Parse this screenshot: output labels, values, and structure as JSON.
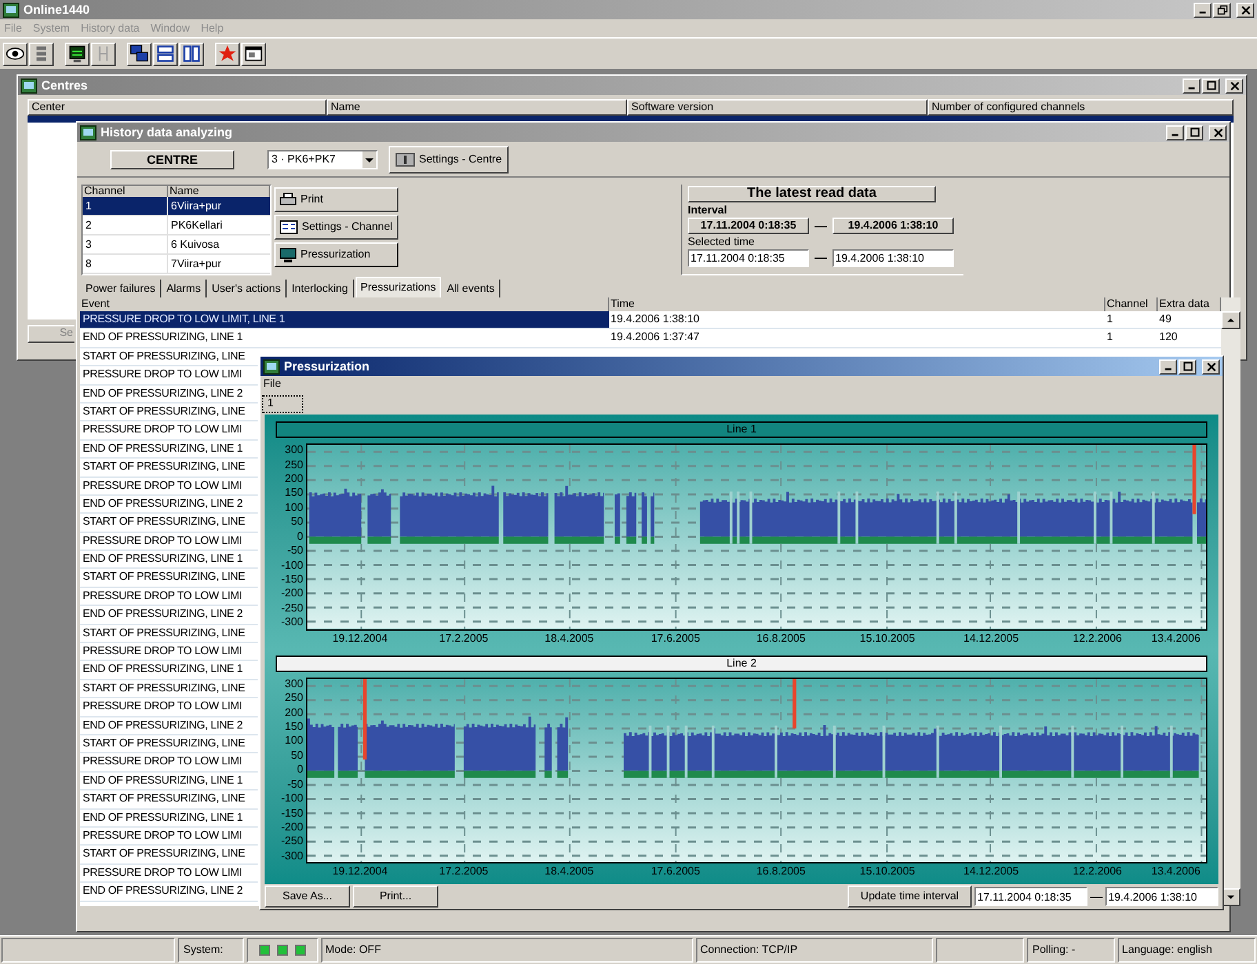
{
  "app": {
    "title": "Online1440",
    "active": false,
    "menu": [
      "File",
      "System",
      "History data",
      "Window",
      "Help"
    ]
  },
  "centres": {
    "title": "Centres",
    "active": false,
    "columns": [
      "Center",
      "Name",
      "Software version",
      "Number of configured channels"
    ],
    "button": "Se"
  },
  "history": {
    "title": "History data analyzing",
    "active": false,
    "centre_label": "CENTRE",
    "centre_value": "3 · PK6+PK7",
    "settings_centre": "Settings - Centre",
    "channels": {
      "columns": [
        "Channel",
        "Name"
      ],
      "rows": [
        {
          "channel": "1",
          "name": "6Viira+pur",
          "selected": true
        },
        {
          "channel": "2",
          "name": "PK6Kellari",
          "selected": false
        },
        {
          "channel": "3",
          "name": "6 Kuivosa",
          "selected": false
        },
        {
          "channel": "8",
          "name": "7Viira+pur",
          "selected": false
        }
      ]
    },
    "actions": [
      {
        "kind": "print",
        "label": "Print"
      },
      {
        "kind": "settings",
        "label": "Settings - Channel"
      },
      {
        "kind": "monitor",
        "label": "Pressurization"
      }
    ],
    "latest": {
      "title": "The latest read data",
      "interval_label": "Interval",
      "interval_from": "17.11.2004 0:18:35",
      "interval_sep": "—",
      "interval_to": "19.4.2006 1:38:10",
      "selected_label": "Selected time",
      "selected_from": "17.11.2004 0:18:35",
      "selected_sep": "—",
      "selected_to": "19.4.2006 1:38:10"
    },
    "tabs": [
      {
        "label": "Power failures",
        "selected": false
      },
      {
        "label": "Alarms",
        "selected": false
      },
      {
        "label": "User's actions",
        "selected": false
      },
      {
        "label": "Interlocking",
        "selected": false
      },
      {
        "label": "Pressurizations",
        "selected": true
      },
      {
        "label": "All events",
        "selected": false
      }
    ],
    "events": {
      "columns": [
        "Event",
        "Time",
        "Channel",
        "Extra data"
      ],
      "rows": [
        {
          "event": "PRESSURE DROP TO LOW LIMIT, LINE 1",
          "time": "19.4.2006 1:38:10",
          "channel": "1",
          "extra": "49",
          "selected": true
        },
        {
          "event": "END OF PRESSURIZING, LINE 1",
          "time": "19.4.2006 1:37:47",
          "channel": "1",
          "extra": "120",
          "selected": false
        },
        {
          "event": "START OF PRESSURIZING, LINE",
          "selected": false
        },
        {
          "event": "PRESSURE DROP TO LOW LIMI",
          "selected": false
        },
        {
          "event": "END OF PRESSURIZING, LINE 2",
          "selected": false
        },
        {
          "event": "START OF PRESSURIZING, LINE",
          "selected": false
        },
        {
          "event": "PRESSURE DROP TO LOW LIMI",
          "selected": false
        },
        {
          "event": "END OF PRESSURIZING, LINE 1",
          "selected": false
        },
        {
          "event": "START OF PRESSURIZING, LINE",
          "selected": false
        },
        {
          "event": "PRESSURE DROP TO LOW LIMI",
          "selected": false
        },
        {
          "event": "END OF PRESSURIZING, LINE 2",
          "selected": false
        },
        {
          "event": "START OF PRESSURIZING, LINE",
          "selected": false
        },
        {
          "event": "PRESSURE DROP TO LOW LIMI",
          "selected": false
        },
        {
          "event": "END OF PRESSURIZING, LINE 1",
          "selected": false
        },
        {
          "event": "START OF PRESSURIZING, LINE",
          "selected": false
        },
        {
          "event": "PRESSURE DROP TO LOW LIMI",
          "selected": false
        },
        {
          "event": "END OF PRESSURIZING, LINE 2",
          "selected": false
        },
        {
          "event": "START OF PRESSURIZING, LINE",
          "selected": false
        },
        {
          "event": "PRESSURE DROP TO LOW LIMI",
          "selected": false
        },
        {
          "event": "END OF PRESSURIZING, LINE 1",
          "selected": false
        },
        {
          "event": "START OF PRESSURIZING, LINE",
          "selected": false
        },
        {
          "event": "PRESSURE DROP TO LOW LIMI",
          "selected": false
        },
        {
          "event": "END OF PRESSURIZING, LINE 2",
          "selected": false
        },
        {
          "event": "START OF PRESSURIZING, LINE",
          "selected": false
        },
        {
          "event": "PRESSURE DROP TO LOW LIMI",
          "selected": false
        },
        {
          "event": "END OF PRESSURIZING, LINE 1",
          "selected": false
        },
        {
          "event": "START OF PRESSURIZING, LINE",
          "selected": false
        },
        {
          "event": "END OF PRESSURIZING, LINE 1",
          "selected": false
        },
        {
          "event": "PRESSURE DROP TO LOW LIMI",
          "selected": false
        },
        {
          "event": "START OF PRESSURIZING, LINE",
          "selected": false
        },
        {
          "event": "PRESSURE DROP TO LOW LIMI",
          "selected": false
        },
        {
          "event": "END OF PRESSURIZING, LINE 2",
          "selected": false
        }
      ]
    }
  },
  "pressurization": {
    "title": "Pressurization",
    "active": true,
    "menu": [
      "File"
    ],
    "tabs": [
      {
        "label": "1",
        "selected": true
      }
    ],
    "charts": [
      {
        "title": "Line 1",
        "yticks": [
          "300",
          "250",
          "200",
          "150",
          "100",
          "50",
          "0",
          "-50",
          "-100",
          "-150",
          "-200",
          "-250",
          "-300"
        ],
        "xticks": [
          "19.12.2004",
          "17.2.2005",
          "18.4.2005",
          "17.6.2005",
          "16.8.2005",
          "15.10.2005",
          "14.12.2005",
          "12.2.2006",
          "13.4.2006"
        ]
      },
      {
        "title": "Line 2",
        "yticks": [
          "300",
          "250",
          "200",
          "150",
          "100",
          "50",
          "0",
          "-50",
          "-100",
          "-150",
          "-200",
          "-250",
          "-300"
        ],
        "xticks": [
          "19.12.2004",
          "17.2.2005",
          "18.4.2005",
          "17.6.2005",
          "16.8.2005",
          "15.10.2005",
          "14.12.2005",
          "12.2.2006",
          "13.4.2006"
        ]
      }
    ],
    "buttons": [
      "Save As...",
      "Print..."
    ],
    "update": "Update time interval",
    "from": "17.11.2004 0:18:35",
    "sep": "—",
    "to": "19.4.2006 1:38:10"
  },
  "status": {
    "system_label": "System:",
    "mode": "Mode: OFF",
    "connection": "Connection: TCP/IP",
    "polling": "Polling: -",
    "language": "Language: english"
  }
}
